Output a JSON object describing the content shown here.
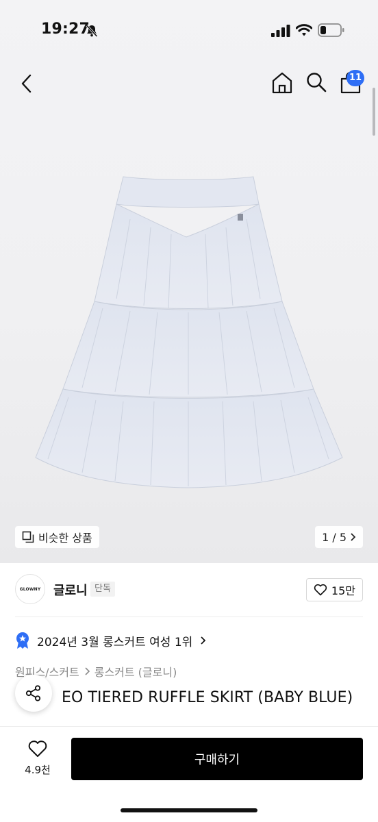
{
  "status_bar": {
    "time": "19:27",
    "icons": [
      "bell-slash-icon",
      "signal-icon",
      "wifi-icon",
      "battery-icon"
    ]
  },
  "nav": {
    "icons": [
      "back-chevron-icon",
      "home-icon",
      "search-icon",
      "cart-icon"
    ],
    "cart_count": "11",
    "badge_color": "#2e6ef5"
  },
  "gallery": {
    "similar_label": "비슷한 상품",
    "pager": "1 / 5"
  },
  "brand": {
    "logo_text": "GLOWNY",
    "name": "글로니",
    "tag": "단독",
    "like_count": "15만"
  },
  "product": {
    "ranking": "2024년 3월 롱스커트 여성 1위",
    "category": [
      "원피스/스커트",
      "롱스커트 (글로니)"
    ],
    "name": "EO TIERED RUFFLE SKIRT (BABY BLUE)"
  },
  "bottom_bar": {
    "wish_count": "4.9천",
    "buy_label": "구매하기"
  }
}
